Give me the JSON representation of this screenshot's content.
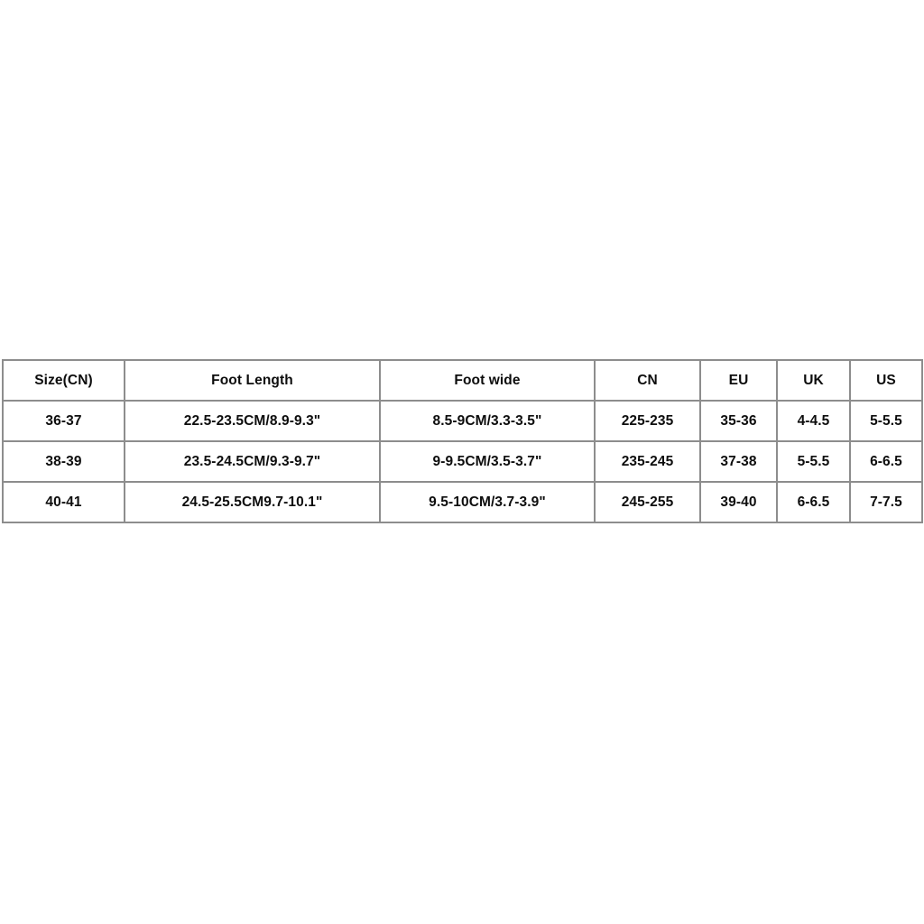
{
  "table": {
    "headers": [
      "Size(CN)",
      "Foot Length",
      "Foot wide",
      "CN",
      "EU",
      "UK",
      "US"
    ],
    "rows": [
      {
        "size_cn": "36-37",
        "foot_length": "22.5-23.5CM/8.9-9.3\"",
        "foot_wide": "8.5-9CM/3.3-3.5\"",
        "cn": "225-235",
        "eu": "35-36",
        "uk": "4-4.5",
        "us": "5-5.5"
      },
      {
        "size_cn": "38-39",
        "foot_length": "23.5-24.5CM/9.3-9.7\"",
        "foot_wide": "9-9.5CM/3.5-3.7\"",
        "cn": "235-245",
        "eu": "37-38",
        "uk": "5-5.5",
        "us": "6-6.5"
      },
      {
        "size_cn": "40-41",
        "foot_length": "24.5-25.5CM9.7-10.1\"",
        "foot_wide": "9.5-10CM/3.7-3.9\"",
        "cn": "245-255",
        "eu": "39-40",
        "uk": "6-6.5",
        "us": "7-7.5"
      }
    ]
  },
  "colors": {
    "background": "#ffffff",
    "border": "#8d8d8d",
    "text": "#0d0d0d"
  }
}
